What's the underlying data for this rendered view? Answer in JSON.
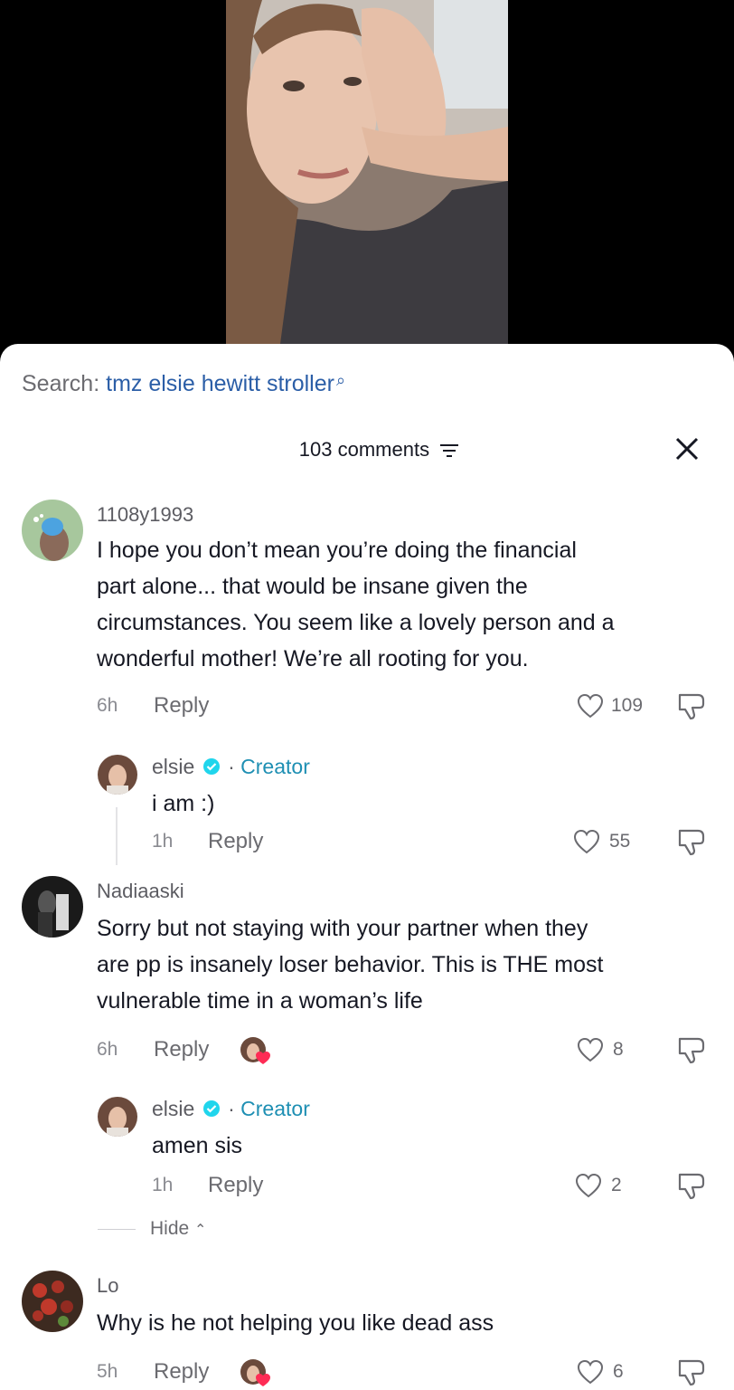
{
  "search": {
    "label": "Search:",
    "query": "tmz elsie hewitt stroller"
  },
  "header": {
    "comment_count": "103 comments"
  },
  "comments": [
    {
      "username": "1108y1993",
      "text_lines": [
        "I hope you don’t mean you’re doing the financial",
        "part alone... that would be insane given the",
        "circumstances. You seem like a lovely person and a",
        "wonderful mother! We’re all rooting for you."
      ],
      "time": "6h",
      "reply": "Reply",
      "likes": "109",
      "reply_item": {
        "username": "elsie",
        "separator": "·",
        "badge": "Creator",
        "text": "i am :)",
        "time": "1h",
        "reply": "Reply",
        "likes": "55"
      }
    },
    {
      "username": "Nadiaaski",
      "text_lines": [
        "Sorry but not staying with your partner when they",
        "are pp is insanely loser behavior. This is THE most",
        "vulnerable time in a woman’s life"
      ],
      "time": "6h",
      "reply": "Reply",
      "likes": "8",
      "reply_item": {
        "username": "elsie",
        "separator": "·",
        "badge": "Creator",
        "text": "amen sis",
        "time": "1h",
        "reply": "Reply",
        "likes": "2"
      },
      "hide_label": "Hide"
    },
    {
      "username": "Lo",
      "text_lines": [
        "Why is he not helping you like dead ass"
      ],
      "time": "5h",
      "reply": "Reply",
      "likes": "6"
    }
  ],
  "colors": {
    "link": "#2b5ea7",
    "creator": "#1e8fb3",
    "verified": "#20d5ec",
    "liked_heart": "#fe2c55"
  },
  "icons": [
    "search-icon",
    "filter-icon",
    "close-icon",
    "heart-icon",
    "dislike-icon",
    "verified-icon",
    "chevron-up-icon"
  ]
}
